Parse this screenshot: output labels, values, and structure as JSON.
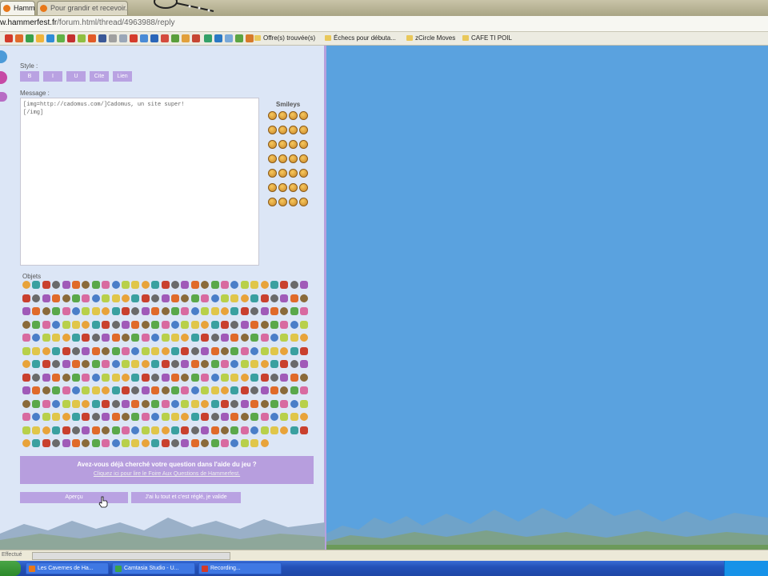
{
  "browser": {
    "tabs": [
      {
        "label": "Hammer...",
        "active": true
      },
      {
        "label": "Pour grandir et recevoir...",
        "active": false
      }
    ],
    "url": {
      "host": "w.hammerfest.fr",
      "path": "/forum.html/thread/4963988/reply"
    },
    "bookmarks": [
      "Offre(s) trouvée(s)",
      "Échecs pour débuta...",
      "zCircle Moves",
      "CAFE TI POIL"
    ],
    "status": "Effectué"
  },
  "forum": {
    "style_label": "Style :",
    "style_buttons": [
      "B",
      "I",
      "U",
      "Cite",
      "Lien"
    ],
    "message_label": "Message :",
    "message_value": "[img=http://cadomus.com/]Cadomus, un site super!\n[/img]",
    "smileys_label": "Smileys",
    "objets_label": "Objets",
    "help_question": "Avez-vous déjà cherché votre question dans l'aide du jeu ?",
    "help_link": "Cliquez ici pour lire le Foire Aux Questions de Hammerfest.",
    "preview_button": "Aperçu",
    "submit_button": "J'ai lu tout et c'est réglé, je valide"
  },
  "taskbar": {
    "items": [
      "Les Cavernes de Ha...",
      "Camtasia Studio - U...",
      "Recording..."
    ]
  },
  "colors": {
    "accent": "#b9a2e2",
    "page_bg": "#5aa2df",
    "forum_bg": "#dce6f6"
  }
}
